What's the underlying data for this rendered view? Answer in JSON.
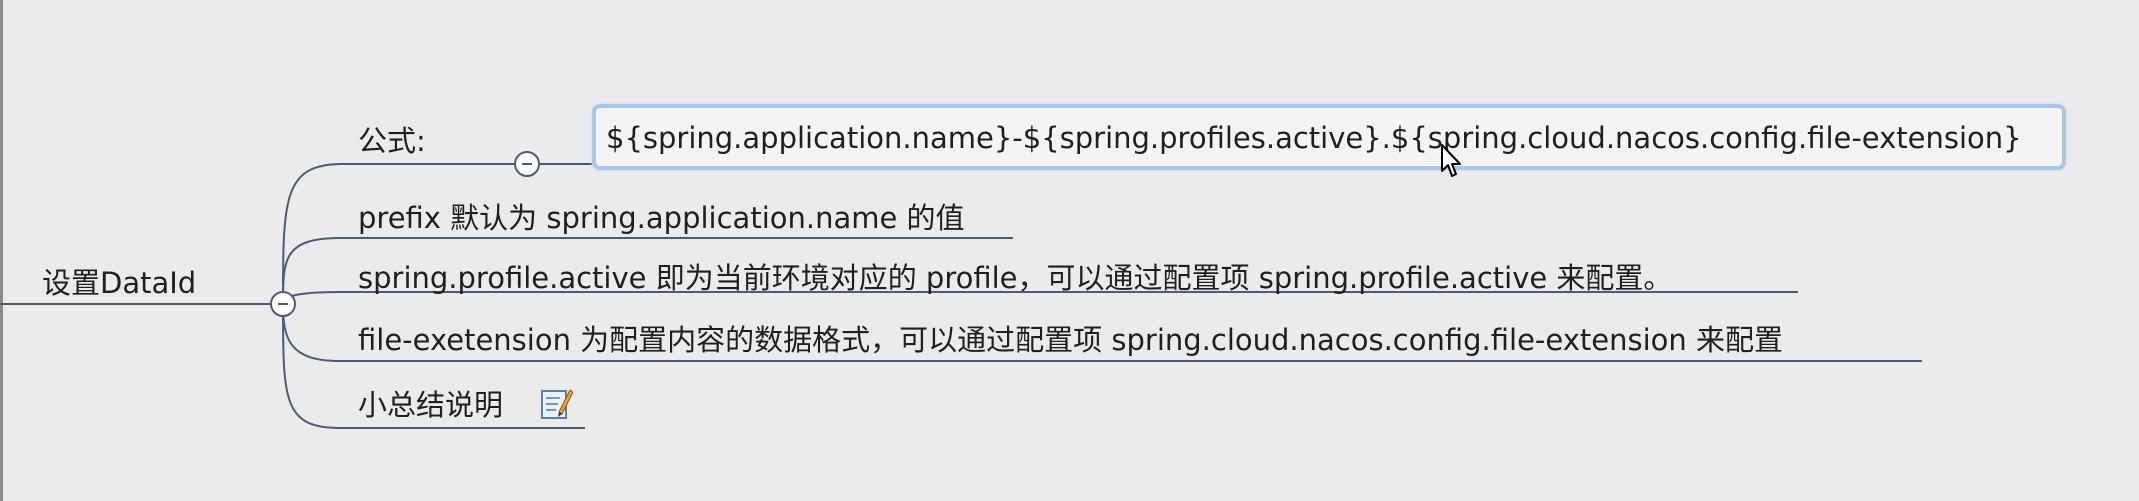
{
  "mindmap": {
    "root": {
      "label": "设置DataId"
    },
    "branches": [
      {
        "label": "公式:"
      },
      {
        "label": "prefix 默认为 spring.application.name 的值"
      },
      {
        "label": "spring.profile.active 即为当前环境对应的 profile，可以通过配置项 spring.profile.active 来配置。"
      },
      {
        "label": "file-exetension 为配置内容的数据格式，可以通过配置项 spring.cloud.nacos.config.file-extension 来配置"
      },
      {
        "label": "小总结说明"
      }
    ],
    "formula": {
      "label": "${spring.application.name}-${spring.profiles.active}.${spring.cloud.nacos.config.file-extension}"
    }
  },
  "icons": {
    "collapse": "minus-circle-icon",
    "memo": "memo-icon",
    "cursor": "mouse-pointer-icon"
  },
  "colors": {
    "background": "#ebebeb",
    "connector": "#4a5d78",
    "selection_border": "#a8c8e6"
  }
}
